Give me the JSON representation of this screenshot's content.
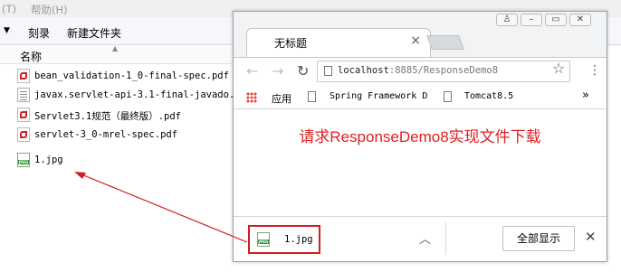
{
  "explorer": {
    "menu": [
      "(T)",
      "帮助(H)"
    ],
    "toolbar": {
      "burn": "刻录",
      "new_folder": "新建文件夹"
    },
    "column_name": "名称",
    "files": [
      {
        "name": "bean_validation-1_0-final-spec.pdf",
        "icon": "pdf-icon"
      },
      {
        "name": "javax.servlet-api-3.1-final-javado...",
        "icon": "document-icon"
      },
      {
        "name": "Servlet3.1规范（最终版）.pdf",
        "icon": "pdf-icon"
      },
      {
        "name": "servlet-3_0-mrel-spec.pdf",
        "icon": "pdf-icon"
      },
      {
        "name": "1.jpg",
        "icon": "jpeg-icon"
      }
    ]
  },
  "browser": {
    "tab_title": "无标题",
    "url_host": "localhost",
    "url_rest": ":8885/ResponseDemo8",
    "bookmarks": {
      "apps": "应用",
      "b1": "Spring Framework D",
      "b2": "Tomcat8.5"
    },
    "heading": "请求ResponseDemo8实现文件下载",
    "download": {
      "filename": "1.jpg",
      "show_all": "全部显示"
    }
  },
  "colors": {
    "highlight_red": "#d01f1f",
    "heading_red": "#e02020"
  }
}
